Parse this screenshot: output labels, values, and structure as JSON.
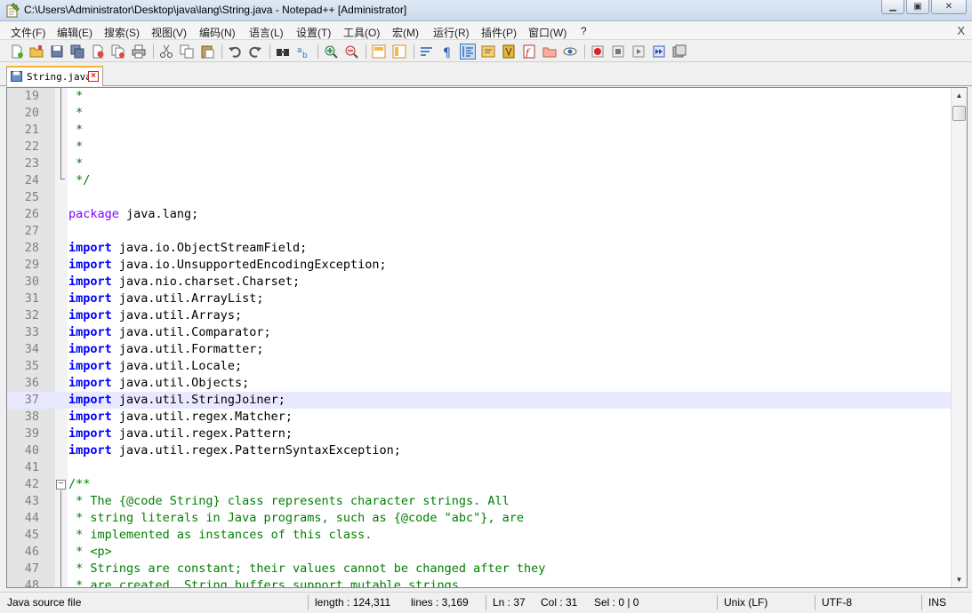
{
  "window": {
    "title": "C:\\Users\\Administrator\\Desktop\\java\\lang\\String.java - Notepad++ [Administrator]"
  },
  "menu": {
    "items": [
      "文件(F)",
      "编辑(E)",
      "搜索(S)",
      "视图(V)",
      "编码(N)",
      "语言(L)",
      "设置(T)",
      "工具(O)",
      "宏(M)",
      "运行(R)",
      "插件(P)",
      "窗口(W)",
      "?"
    ],
    "close_label": "X"
  },
  "toolbar": {
    "icons": [
      "new-file-icon",
      "open-file-icon",
      "save-icon",
      "save-all-icon",
      "close-icon",
      "close-all-icon",
      "print-icon",
      "cut-icon",
      "copy-icon",
      "paste-icon",
      "undo-icon",
      "redo-icon",
      "find-icon",
      "replace-icon",
      "zoom-in-icon",
      "zoom-out-icon",
      "sync-vertical-icon",
      "sync-horizontal-icon",
      "word-wrap-icon",
      "show-all-chars-icon",
      "indent-guide-icon",
      "language-define-icon",
      "doc-map-icon",
      "function-list-icon",
      "folder-as-workspace-icon",
      "monitoring-icon",
      "record-macro-icon",
      "stop-record-icon",
      "playback-macro-icon",
      "run-macro-multiple-icon",
      "save-macro-icon"
    ],
    "active": "indent-guide-icon"
  },
  "tabs": [
    {
      "label": "String.java",
      "active": true
    }
  ],
  "editor": {
    "current_line": 37,
    "lines": [
      {
        "n": "19",
        "text": " *"
      },
      {
        "n": "20",
        "text": " *"
      },
      {
        "n": "21",
        "text": " *"
      },
      {
        "n": "22",
        "text": " *"
      },
      {
        "n": "23",
        "text": " *"
      },
      {
        "n": "24",
        "text": " */"
      },
      {
        "n": "25",
        "text": ""
      },
      {
        "n": "26",
        "kw": "package",
        "text": " java.lang;"
      },
      {
        "n": "27",
        "text": ""
      },
      {
        "n": "28",
        "kw": "import",
        "text": " java.io.ObjectStreamField;"
      },
      {
        "n": "29",
        "kw": "import",
        "text": " java.io.UnsupportedEncodingException;"
      },
      {
        "n": "30",
        "kw": "import",
        "text": " java.nio.charset.Charset;"
      },
      {
        "n": "31",
        "kw": "import",
        "text": " java.util.ArrayList;"
      },
      {
        "n": "32",
        "kw": "import",
        "text": " java.util.Arrays;"
      },
      {
        "n": "33",
        "kw": "import",
        "text": " java.util.Comparator;"
      },
      {
        "n": "34",
        "kw": "import",
        "text": " java.util.Formatter;"
      },
      {
        "n": "35",
        "kw": "import",
        "text": " java.util.Locale;"
      },
      {
        "n": "36",
        "kw": "import",
        "text": " java.util.Objects;"
      },
      {
        "n": "37",
        "kw": "import",
        "text": " java.util.StringJoiner;"
      },
      {
        "n": "38",
        "kw": "import",
        "text": " java.util.regex.Matcher;"
      },
      {
        "n": "39",
        "kw": "import",
        "text": " java.util.regex.Pattern;"
      },
      {
        "n": "40",
        "kw": "import",
        "text": " java.util.regex.PatternSyntaxException;"
      },
      {
        "n": "41",
        "text": ""
      },
      {
        "n": "42",
        "text": "/**"
      },
      {
        "n": "43",
        "text": " * The {@code String} class represents character strings. All"
      },
      {
        "n": "44",
        "text": " * string literals in Java programs, such as {@code \"abc\"}, are"
      },
      {
        "n": "45",
        "text": " * implemented as instances of this class."
      },
      {
        "n": "46",
        "text": " * <p>"
      },
      {
        "n": "47",
        "text": " * Strings are constant; their values cannot be changed after they"
      },
      {
        "n": "48",
        "text": " * are created. String buffers support mutable strings."
      }
    ]
  },
  "status": {
    "file_type": "Java source file",
    "length": "length : 124,311",
    "lines": "lines : 3,169",
    "ln": "Ln : 37",
    "col": "Col : 31",
    "sel": "Sel : 0 | 0",
    "eol": "Unix (LF)",
    "encoding": "UTF-8",
    "mode": "INS"
  },
  "colors": {
    "keyword_import": "#0000ff",
    "keyword_package": "#8000ff",
    "comment": "#008000",
    "line_number": "#808080",
    "current_line_bg": "#e8e8ff"
  }
}
